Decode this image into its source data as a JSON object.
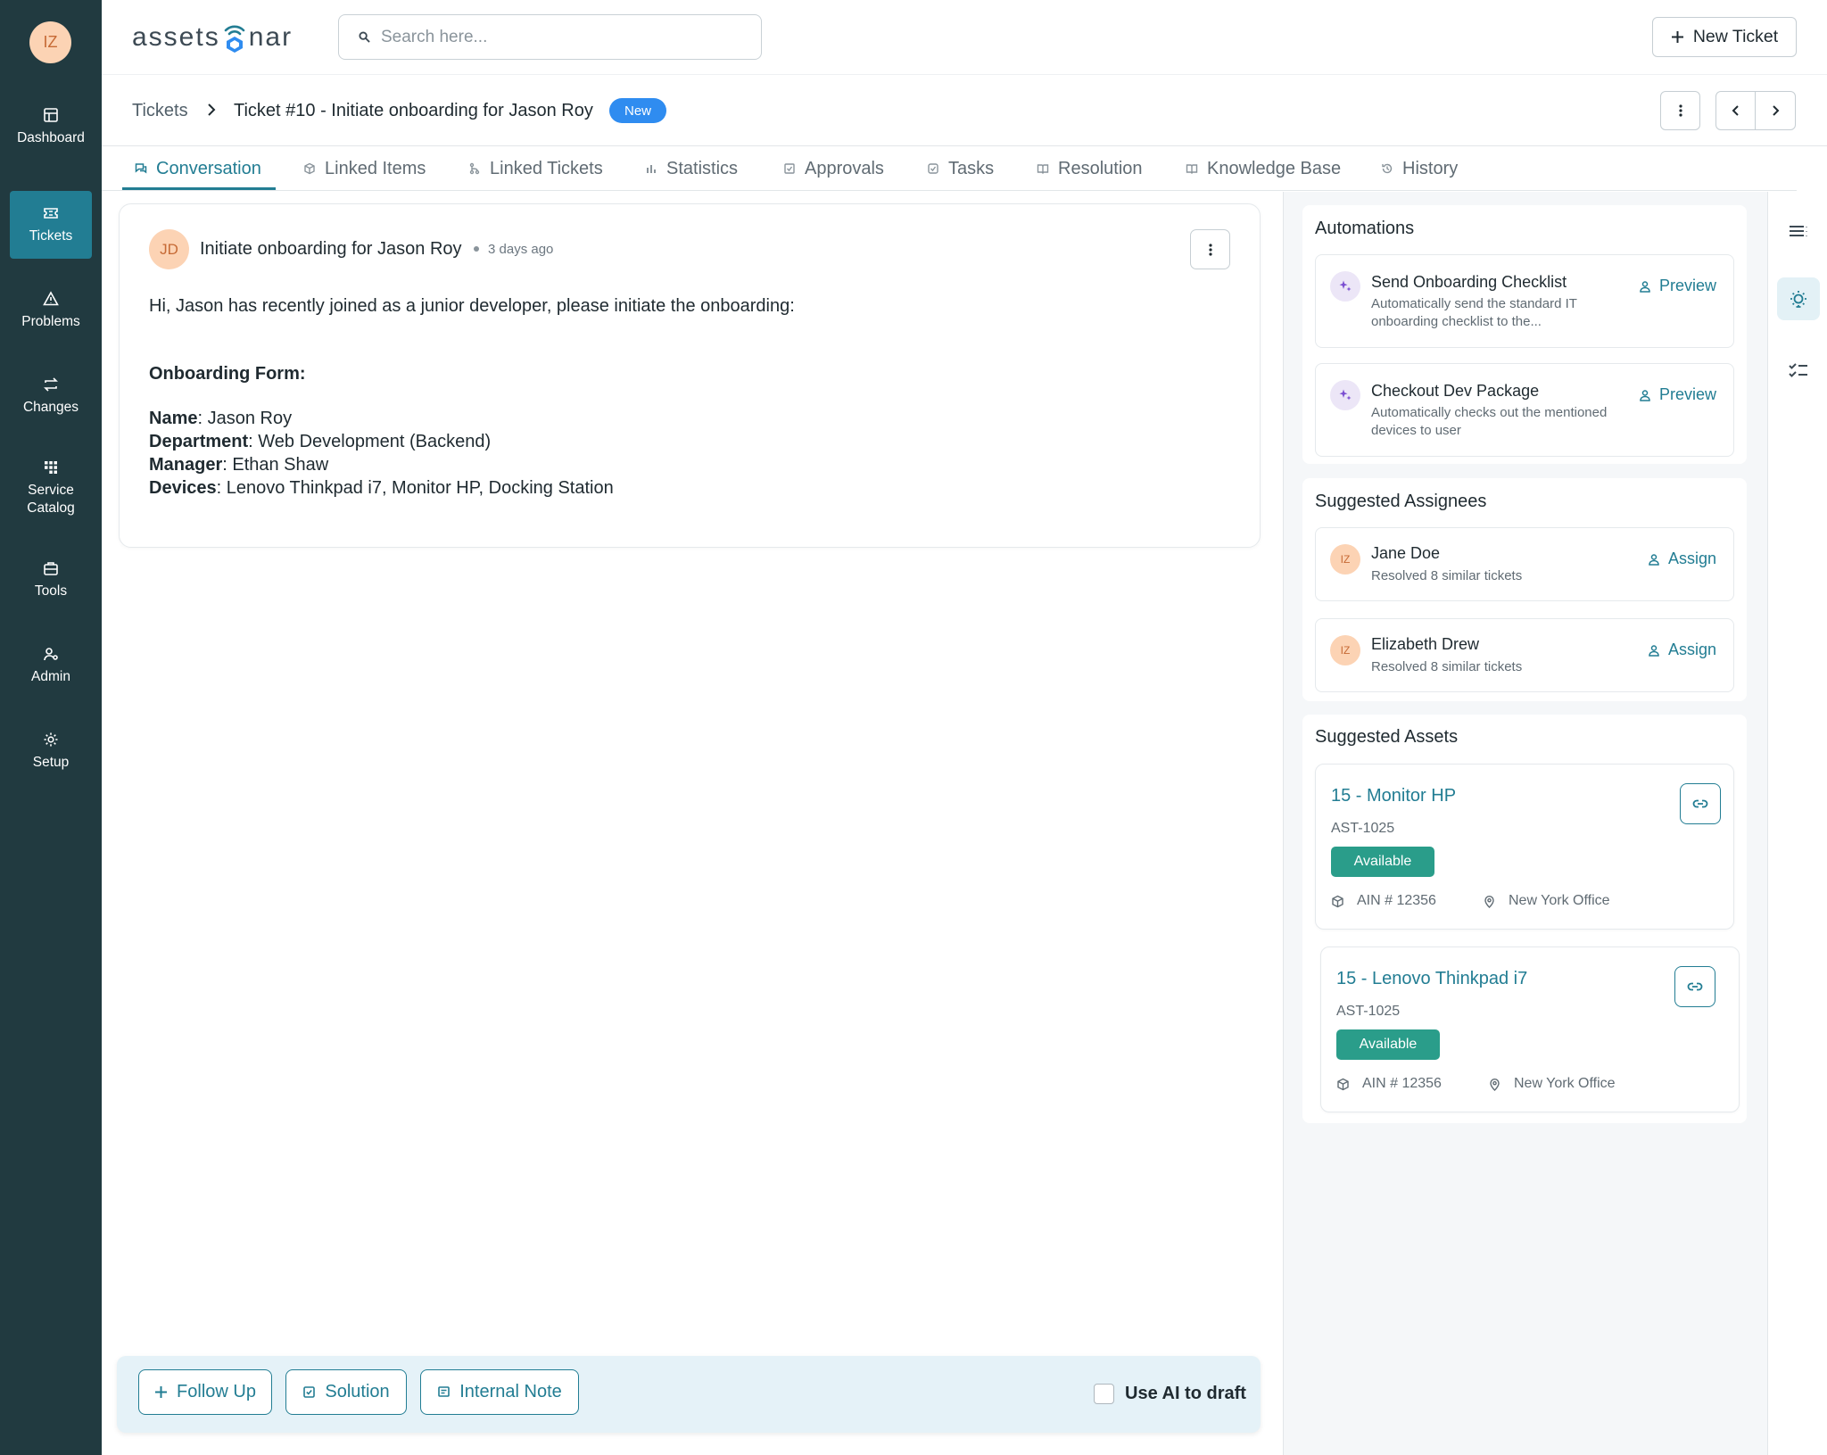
{
  "user": {
    "initials": "IZ"
  },
  "sidebar": {
    "items": [
      {
        "label": "Dashboard",
        "icon": "dashboard-icon"
      },
      {
        "label": "Tickets",
        "icon": "ticket-icon",
        "active": true
      },
      {
        "label": "Problems",
        "icon": "warning-icon"
      },
      {
        "label": "Changes",
        "icon": "swap-icon"
      },
      {
        "label": "Service Catalog",
        "icon": "catalog-icon"
      },
      {
        "label": "Tools",
        "icon": "toolbox-icon"
      },
      {
        "label": "Admin",
        "icon": "admin-icon"
      },
      {
        "label": "Setup",
        "icon": "gear-icon"
      }
    ]
  },
  "header": {
    "logo_left": "assets",
    "logo_right": "nar",
    "search_placeholder": "Search here...",
    "new_ticket_label": "New Ticket"
  },
  "breadcrumb": {
    "root": "Tickets",
    "title": "Ticket #10 - Initiate onboarding for Jason Roy",
    "status": "New"
  },
  "tabs": [
    {
      "label": "Conversation",
      "icon": "chat-icon",
      "active": true
    },
    {
      "label": "Linked Items",
      "icon": "cube-icon"
    },
    {
      "label": "Linked Tickets",
      "icon": "branch-icon"
    },
    {
      "label": "Statistics",
      "icon": "bar-chart-icon"
    },
    {
      "label": "Approvals",
      "icon": "check-square-icon"
    },
    {
      "label": "Tasks",
      "icon": "task-icon"
    },
    {
      "label": "Resolution",
      "icon": "book-icon"
    },
    {
      "label": "Knowledge Base",
      "icon": "book-open-icon"
    },
    {
      "label": "History",
      "icon": "history-icon"
    }
  ],
  "message": {
    "avatar_initials": "JD",
    "title": "Initiate onboarding for Jason Roy",
    "time": "3 days ago",
    "intro": "Hi, Jason has recently joined as a junior developer, please initiate the onboarding:",
    "form_title": "Onboarding Form:",
    "fields": [
      {
        "label": "Name",
        "value": ": Jason Roy"
      },
      {
        "label": "Department",
        "value": ": Web Development (Backend)"
      },
      {
        "label": "Manager",
        "value": ": Ethan Shaw"
      },
      {
        "label": "Devices",
        "value": ": Lenovo Thinkpad i7, Monitor HP, Docking Station"
      }
    ]
  },
  "composer": {
    "follow_up": "Follow Up",
    "solution": "Solution",
    "internal_note": "Internal Note",
    "ai_label": "Use AI to draft",
    "ai_checked": false
  },
  "automations": {
    "title": "Automations",
    "items": [
      {
        "title": "Send Onboarding Checklist",
        "desc": "Automatically send the standard IT onboarding checklist to the...",
        "action": "Preview"
      },
      {
        "title": "Checkout Dev Package",
        "desc": "Automatically checks out the mentioned devices to user",
        "action": "Preview"
      }
    ]
  },
  "assignees": {
    "title": "Suggested Assignees",
    "items": [
      {
        "initials": "IZ",
        "name": "Jane Doe",
        "sub": "Resolved 8 similar tickets",
        "action": "Assign"
      },
      {
        "initials": "IZ",
        "name": "Elizabeth Drew",
        "sub": "Resolved 8 similar tickets",
        "action": "Assign"
      }
    ]
  },
  "assets": {
    "title": "Suggested Assets",
    "items": [
      {
        "name": "15 - Monitor HP",
        "code": "AST-1025",
        "status": "Available",
        "ain": "AIN # 12356",
        "location": "New York Office"
      },
      {
        "name": "15 - Lenovo Thinkpad i7",
        "code": "AST-1025",
        "status": "Available",
        "ain": "AIN # 12356",
        "location": "New York Office"
      }
    ]
  },
  "colors": {
    "sidebar_bg": "#213a40",
    "accent": "#227d93",
    "status_new": "#2f8cf0",
    "status_available": "#2a9d8a"
  }
}
